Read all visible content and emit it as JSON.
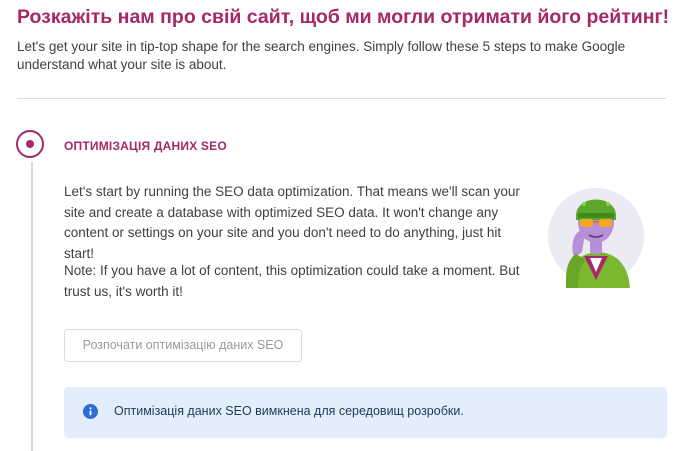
{
  "page": {
    "title": "Розкажіть нам про свій сайт, щоб ми могли отримати його рейтинг!",
    "intro": "Let's get your site in tip-top shape for the search engines. Simply follow these 5 steps to make Google understand what your site is about."
  },
  "step": {
    "title": "ОПТИМІЗАЦІЯ ДАНИХ SEO",
    "body": "Let's start by running the SEO data optimization. That means we'll scan your site and create a database with optimized SEO data. It won't change any content or settings on your site and you don't need to do anything, just hit start!",
    "note": "Note: If you have a lot of content, this optimization could take a moment. But trust us, it's worth it!",
    "button_label": "Розпочати оптимізацію даних SEO"
  },
  "alert": {
    "icon": "info-icon",
    "text": "Оптимізація даних SEO вимкнена для середовищ розробки."
  },
  "colors": {
    "accent": "#a4286a",
    "alert_bg": "#e2eefa",
    "info_icon": "#2c6cd6"
  }
}
